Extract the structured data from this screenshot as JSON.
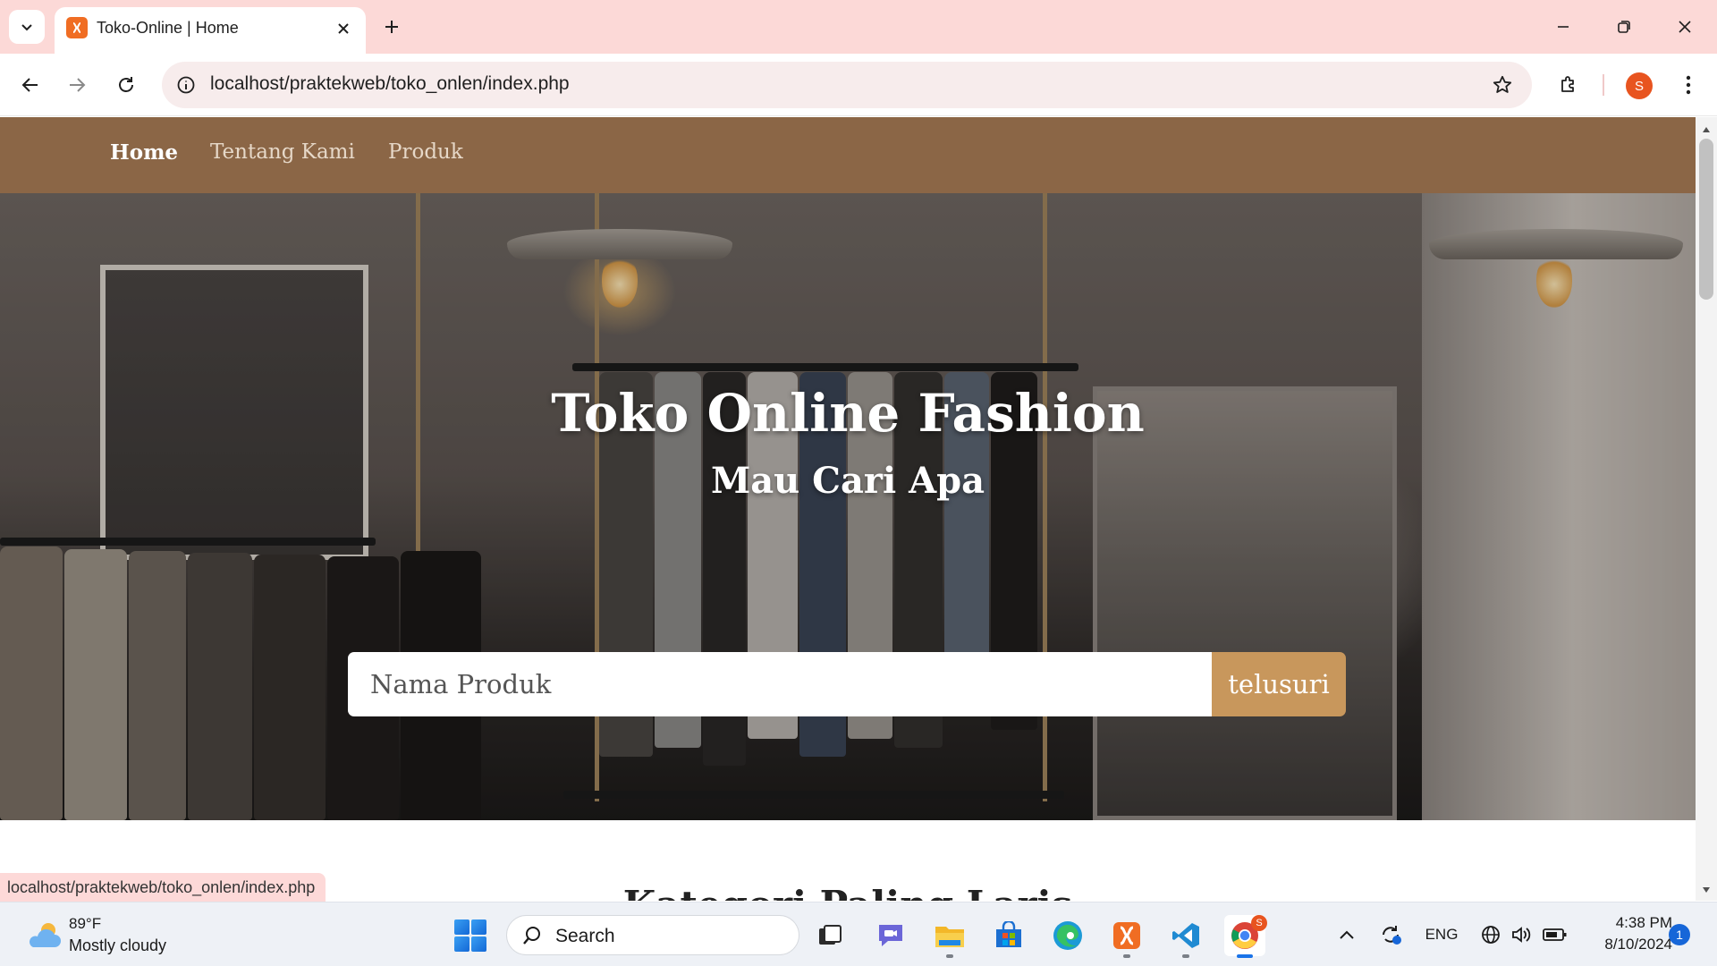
{
  "browser": {
    "tab": {
      "title": "Toko-Online | Home",
      "favicon": "xampp-icon"
    },
    "url": "localhost/praktekweb/toko_onlen/index.php",
    "profile_initial": "S",
    "status_url": "localhost/praktekweb/toko_onlen/index.php"
  },
  "site": {
    "nav": [
      {
        "label": "Home",
        "active": true
      },
      {
        "label": "Tentang Kami",
        "active": false
      },
      {
        "label": "Produk",
        "active": false
      }
    ],
    "hero": {
      "title": "Toko Online Fashion",
      "subtitle": "Mau Cari Apa",
      "search_placeholder": "Nama Produk",
      "search_button": "telusuri"
    },
    "section_heading": "Kategori Paling Laris"
  },
  "taskbar": {
    "weather": {
      "temp": "89°F",
      "desc": "Mostly cloudy",
      "icon": "partly-cloudy-icon"
    },
    "search_label": "Search",
    "apps": [
      "task-view-icon",
      "teams-chat-icon",
      "file-explorer-icon",
      "microsoft-store-icon",
      "edge-icon",
      "xampp-icon",
      "vscode-icon",
      "chrome-icon"
    ],
    "chrome_badge": "S",
    "language": "ENG",
    "time": "4:38 PM",
    "date": "8/10/2024",
    "notifications": "1"
  },
  "colors": {
    "nav_bg": "#8b6646",
    "search_button_bg": "#c8975c",
    "tabbar_bg": "#fcd9d7"
  }
}
